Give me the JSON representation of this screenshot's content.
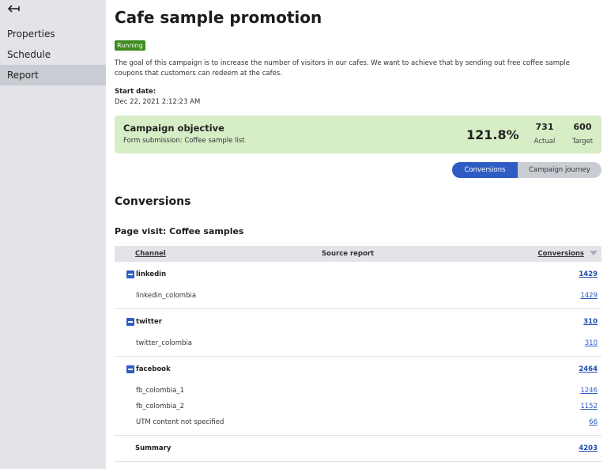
{
  "sidebar": {
    "items": [
      {
        "label": "Properties",
        "active": false
      },
      {
        "label": "Schedule",
        "active": false
      },
      {
        "label": "Report",
        "active": true
      }
    ]
  },
  "header": {
    "title": "Cafe sample promotion",
    "status": "Running",
    "status_color": "#3e8a1c",
    "description": "The goal of this campaign is to increase the number of visitors in our cafes. We want to achieve that by sending out free coffee sample coupons that customers can redeem at the cafes.",
    "start_label": "Start date:",
    "start_value": "Dec 22, 2021 2:12:23 AM"
  },
  "objective": {
    "title": "Campaign objective",
    "subtitle": "Form submission: Coffee sample list",
    "percent": "121.8%",
    "actual_value": "731",
    "actual_label": "Actual",
    "target_value": "600",
    "target_label": "Target",
    "background": "#d6edc6"
  },
  "view_toggle": {
    "active": "Conversions",
    "inactive": "Campaign journey",
    "accent": "#2f5cc4"
  },
  "report": {
    "section_title": "Conversions",
    "subtitle": "Page visit: Coffee samples",
    "columns": {
      "channel": "Channel",
      "source": "Source report",
      "conversions": "Conversions"
    },
    "groups": [
      {
        "name": "linkedin",
        "total": "1429",
        "rows": [
          {
            "name": "linkedin_colombia",
            "value": "1429"
          }
        ]
      },
      {
        "name": "twitter",
        "total": "310",
        "rows": [
          {
            "name": "twitter_colombia",
            "value": "310"
          }
        ]
      },
      {
        "name": "facebook",
        "total": "2464",
        "rows": [
          {
            "name": "fb_colombia_1",
            "value": "1246"
          },
          {
            "name": "fb_colombia_2",
            "value": "1152"
          },
          {
            "name": "UTM content not specified",
            "value": "66"
          }
        ]
      }
    ],
    "summary_label": "Summary",
    "summary_value": "4203"
  }
}
